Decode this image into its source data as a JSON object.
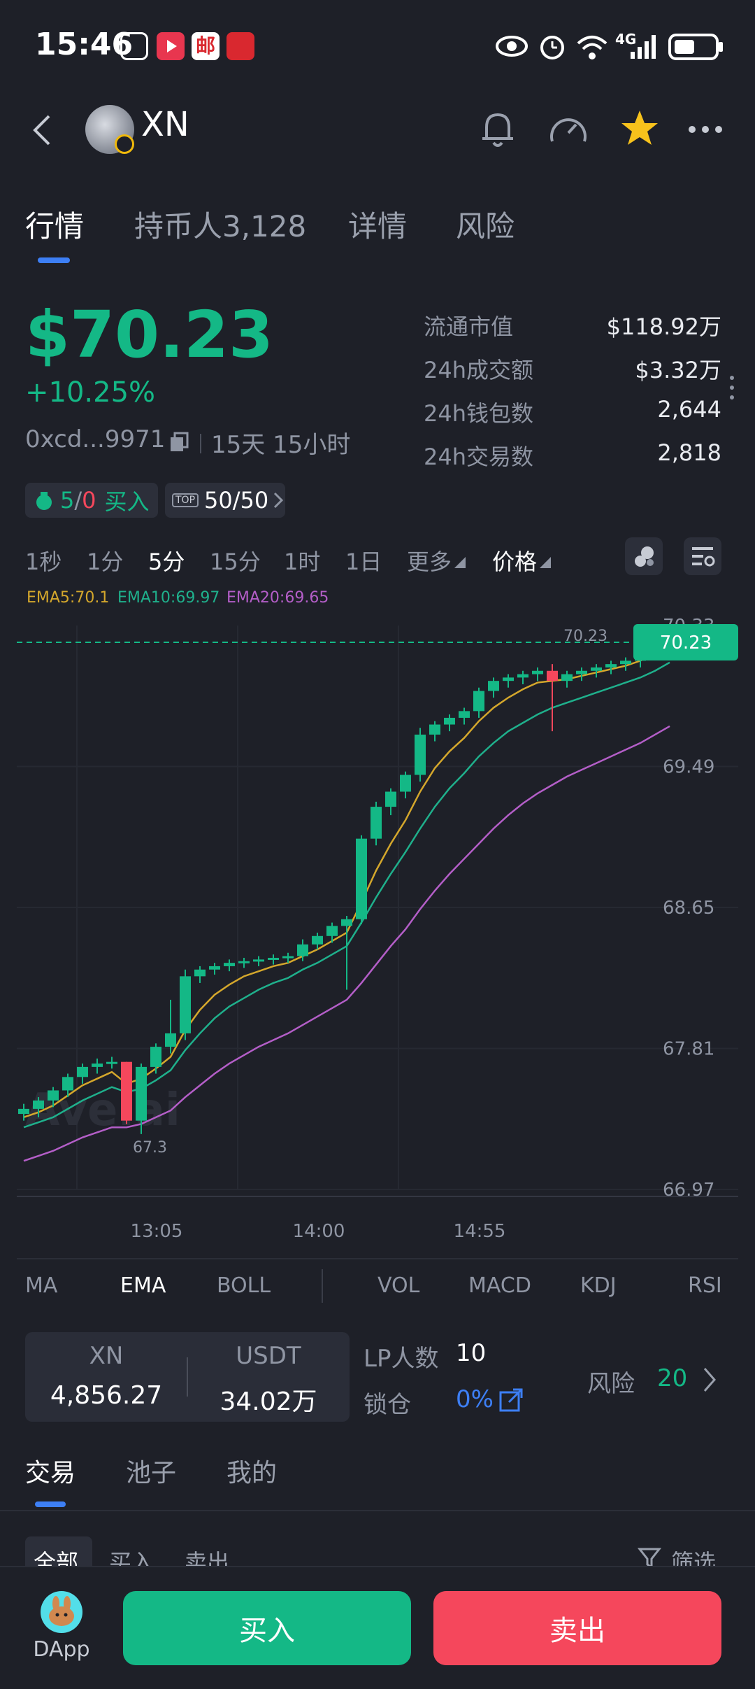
{
  "status_bar": {
    "time": "15:46",
    "network": "4G"
  },
  "header": {
    "title": "XN"
  },
  "tabs": [
    {
      "label": "行情"
    },
    {
      "label": "持币人3,128"
    },
    {
      "label": "详情"
    },
    {
      "label": "风险"
    }
  ],
  "price": {
    "value": "$70.23",
    "change": "+10.25%",
    "address": "0xcd...9971",
    "age": "15天 15小时"
  },
  "stats": [
    {
      "label": "流通市值",
      "value": "$118.92万"
    },
    {
      "label": "24h成交额",
      "value": "$3.32万"
    },
    {
      "label": "24h钱包数",
      "value": "2,644"
    },
    {
      "label": "24h交易数",
      "value": "2,818"
    }
  ],
  "chips": {
    "smart_a": "5",
    "smart_sep": "/",
    "smart_b": "0",
    "smart_label": "买入",
    "top_badge": "TOP",
    "top_value": "50/50"
  },
  "timeframes": [
    "1秒",
    "1分",
    "5分",
    "15分",
    "1时",
    "1日"
  ],
  "more_label": "更多",
  "price_label": "价格",
  "ema_legend": {
    "ema5": "EMA5:70.1",
    "ema10": "EMA10:69.97",
    "ema20": "EMA20:69.65"
  },
  "colors": {
    "up": "#14b886",
    "down": "#f5475c",
    "ema5": "#d4a72c",
    "ema10": "#1fb08c",
    "ema20": "#b45ec8",
    "accent": "#3d7ff5"
  },
  "chart_data": {
    "type": "candlestick",
    "x_ticks": [
      "13:05",
      "14:00",
      "14:55"
    ],
    "y_ticks": [
      70.33,
      69.49,
      68.65,
      67.81,
      66.97
    ],
    "ylim": [
      66.97,
      70.33
    ],
    "last_price_label": "70.23",
    "last_price_line": "70.23",
    "low_annotation": "67.3",
    "watermark": "Ave.ai",
    "candles": [
      {
        "o": 67.42,
        "h": 67.48,
        "l": 67.38,
        "c": 67.45
      },
      {
        "o": 67.45,
        "h": 67.52,
        "l": 67.4,
        "c": 67.5
      },
      {
        "o": 67.5,
        "h": 67.58,
        "l": 67.46,
        "c": 67.56
      },
      {
        "o": 67.56,
        "h": 67.66,
        "l": 67.52,
        "c": 67.64
      },
      {
        "o": 67.64,
        "h": 67.72,
        "l": 67.6,
        "c": 67.7
      },
      {
        "o": 67.7,
        "h": 67.75,
        "l": 67.66,
        "c": 67.72
      },
      {
        "o": 67.72,
        "h": 67.76,
        "l": 67.69,
        "c": 67.73
      },
      {
        "o": 67.73,
        "h": 67.73,
        "l": 67.36,
        "c": 67.38
      },
      {
        "o": 67.38,
        "h": 67.72,
        "l": 67.3,
        "c": 67.7
      },
      {
        "o": 67.7,
        "h": 67.84,
        "l": 67.66,
        "c": 67.82
      },
      {
        "o": 67.82,
        "h": 68.1,
        "l": 67.78,
        "c": 67.9
      },
      {
        "o": 67.9,
        "h": 68.28,
        "l": 67.86,
        "c": 68.24
      },
      {
        "o": 68.24,
        "h": 68.3,
        "l": 68.2,
        "c": 68.28
      },
      {
        "o": 68.28,
        "h": 68.32,
        "l": 68.25,
        "c": 68.3
      },
      {
        "o": 68.3,
        "h": 68.34,
        "l": 68.27,
        "c": 68.32
      },
      {
        "o": 68.32,
        "h": 68.35,
        "l": 68.29,
        "c": 68.33
      },
      {
        "o": 68.33,
        "h": 68.36,
        "l": 68.3,
        "c": 68.34
      },
      {
        "o": 68.34,
        "h": 68.37,
        "l": 68.31,
        "c": 68.35
      },
      {
        "o": 68.35,
        "h": 68.38,
        "l": 68.32,
        "c": 68.36
      },
      {
        "o": 68.36,
        "h": 68.46,
        "l": 68.33,
        "c": 68.43
      },
      {
        "o": 68.43,
        "h": 68.5,
        "l": 68.4,
        "c": 68.48
      },
      {
        "o": 68.48,
        "h": 68.56,
        "l": 68.44,
        "c": 68.54
      },
      {
        "o": 68.54,
        "h": 68.6,
        "l": 68.16,
        "c": 68.58
      },
      {
        "o": 68.58,
        "h": 69.08,
        "l": 68.55,
        "c": 69.06
      },
      {
        "o": 69.06,
        "h": 69.28,
        "l": 69.02,
        "c": 69.25
      },
      {
        "o": 69.25,
        "h": 69.36,
        "l": 69.2,
        "c": 69.34
      },
      {
        "o": 69.34,
        "h": 69.46,
        "l": 69.3,
        "c": 69.44
      },
      {
        "o": 69.44,
        "h": 69.72,
        "l": 69.4,
        "c": 69.68
      },
      {
        "o": 69.68,
        "h": 69.76,
        "l": 69.64,
        "c": 69.74
      },
      {
        "o": 69.74,
        "h": 69.8,
        "l": 69.7,
        "c": 69.78
      },
      {
        "o": 69.78,
        "h": 69.84,
        "l": 69.74,
        "c": 69.82
      },
      {
        "o": 69.82,
        "h": 69.96,
        "l": 69.78,
        "c": 69.94
      },
      {
        "o": 69.94,
        "h": 70.02,
        "l": 69.9,
        "c": 70.0
      },
      {
        "o": 70.0,
        "h": 70.04,
        "l": 69.96,
        "c": 70.02
      },
      {
        "o": 70.02,
        "h": 70.06,
        "l": 69.98,
        "c": 70.04
      },
      {
        "o": 70.04,
        "h": 70.08,
        "l": 70.0,
        "c": 70.06
      },
      {
        "o": 70.06,
        "h": 70.1,
        "l": 69.7,
        "c": 70.0
      },
      {
        "o": 70.0,
        "h": 70.06,
        "l": 69.96,
        "c": 70.04
      },
      {
        "o": 70.04,
        "h": 70.08,
        "l": 70.0,
        "c": 70.06
      },
      {
        "o": 70.06,
        "h": 70.1,
        "l": 70.02,
        "c": 70.08
      },
      {
        "o": 70.08,
        "h": 70.12,
        "l": 70.04,
        "c": 70.1
      },
      {
        "o": 70.1,
        "h": 70.14,
        "l": 70.06,
        "c": 70.12
      },
      {
        "o": 70.12,
        "h": 70.2,
        "l": 70.08,
        "c": 70.18
      },
      {
        "o": 70.18,
        "h": 70.28,
        "l": 70.14,
        "c": 70.26
      },
      {
        "o": 70.26,
        "h": 70.32,
        "l": 70.22,
        "c": 70.3
      }
    ],
    "ema5": [
      67.4,
      67.43,
      67.47,
      67.53,
      67.59,
      67.63,
      67.67,
      67.6,
      67.63,
      67.69,
      67.76,
      67.92,
      68.04,
      68.13,
      68.19,
      68.24,
      68.27,
      68.3,
      68.32,
      68.36,
      68.4,
      68.45,
      68.5,
      68.68,
      68.87,
      69.03,
      69.17,
      69.34,
      69.48,
      69.58,
      69.66,
      69.76,
      69.84,
      69.9,
      69.95,
      69.99,
      70.0,
      70.01,
      70.03,
      70.05,
      70.07,
      70.09,
      70.12,
      70.17,
      70.23
    ],
    "ema10": [
      67.34,
      67.37,
      67.4,
      67.45,
      67.5,
      67.54,
      67.58,
      67.55,
      67.57,
      67.62,
      67.68,
      67.8,
      67.9,
      67.99,
      68.06,
      68.11,
      68.16,
      68.2,
      68.23,
      68.28,
      68.32,
      68.37,
      68.42,
      68.56,
      68.71,
      68.85,
      68.98,
      69.12,
      69.25,
      69.36,
      69.45,
      69.55,
      69.63,
      69.7,
      69.75,
      69.8,
      69.84,
      69.87,
      69.9,
      69.93,
      69.96,
      69.99,
      70.02,
      70.06,
      70.11
    ],
    "ema20": [
      67.14,
      67.17,
      67.2,
      67.24,
      67.28,
      67.31,
      67.34,
      67.34,
      67.36,
      67.4,
      67.44,
      67.52,
      67.59,
      67.66,
      67.72,
      67.77,
      67.82,
      67.86,
      67.9,
      67.95,
      68.0,
      68.05,
      68.1,
      68.2,
      68.31,
      68.42,
      68.52,
      68.64,
      68.75,
      68.85,
      68.94,
      69.03,
      69.12,
      69.2,
      69.27,
      69.33,
      69.38,
      69.43,
      69.47,
      69.51,
      69.55,
      69.59,
      69.63,
      69.68,
      69.73
    ]
  },
  "indicators": [
    "MA",
    "EMA",
    "BOLL",
    "VOL",
    "MACD",
    "KDJ",
    "RSI"
  ],
  "pool": {
    "token_a": "XN",
    "token_a_amount": "4,856.27",
    "token_b": "USDT",
    "token_b_amount": "34.02万",
    "lp_label": "LP人数",
    "lp_value": "10",
    "lock_label": "锁仓",
    "lock_value": "0%",
    "risk_label": "风险",
    "risk_value": "20"
  },
  "bottom_tabs": [
    "交易",
    "池子",
    "我的"
  ],
  "filters": [
    "全部",
    "买入",
    "卖出"
  ],
  "filter_button": "筛选",
  "bottom_bar": {
    "dapp_label": "DApp",
    "buy_label": "买入",
    "sell_label": "卖出"
  }
}
